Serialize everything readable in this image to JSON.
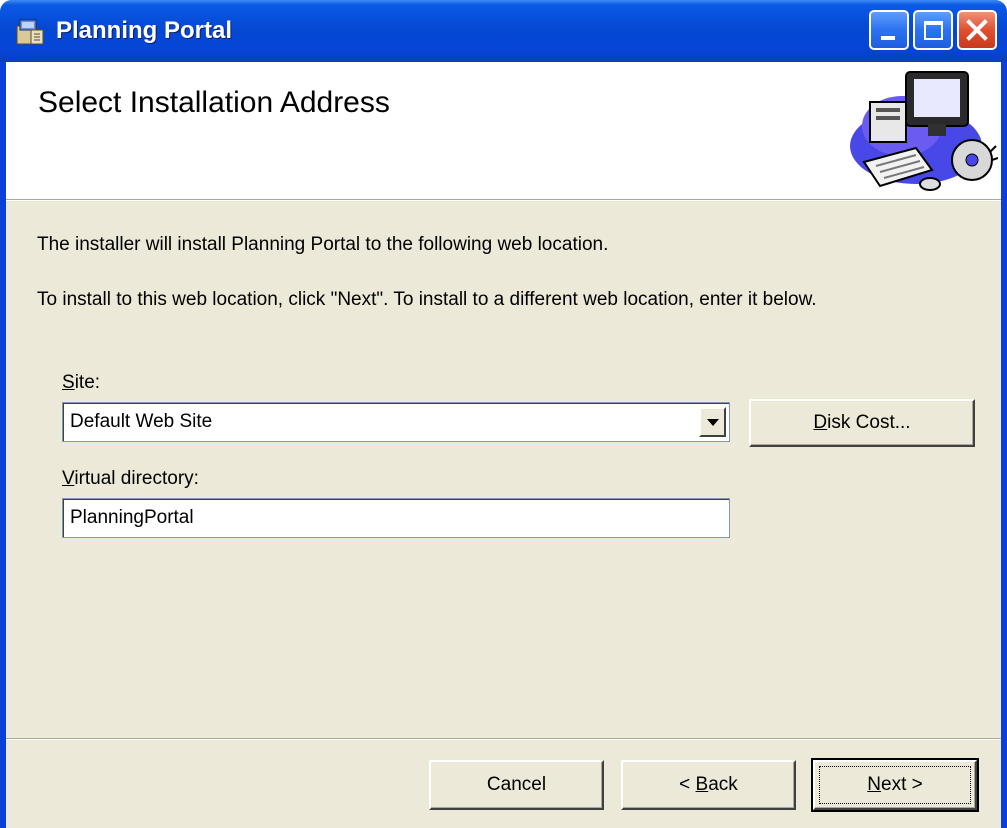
{
  "window": {
    "title": "Planning Portal",
    "icon": "installer-package-icon",
    "controls": [
      "minimize",
      "maximize",
      "close"
    ]
  },
  "banner": {
    "title": "Select Installation Address",
    "art": "computer-with-cd-icon"
  },
  "body": {
    "description_1": "The installer will install Planning Portal to the following web location.",
    "description_2": "To install to this web location, click \"Next\". To install to a different web location, enter it below."
  },
  "site": {
    "label_accel": "S",
    "label_rest": "ite:",
    "value": "Default Web Site"
  },
  "virtual_directory": {
    "label_accel": "V",
    "label_rest": "irtual directory:",
    "value": "PlanningPortal"
  },
  "buttons": {
    "disk_cost_accel": "D",
    "disk_cost_rest": "isk Cost...",
    "cancel": "Cancel",
    "back_prefix": "< ",
    "back_accel": "B",
    "back_rest": "ack",
    "next_accel": "N",
    "next_rest": "ext >"
  },
  "colors": {
    "titlebar": "#0548d4",
    "close_button": "#e0502f",
    "dialog_background": "#ece9d8",
    "banner_background": "#ffffff"
  }
}
